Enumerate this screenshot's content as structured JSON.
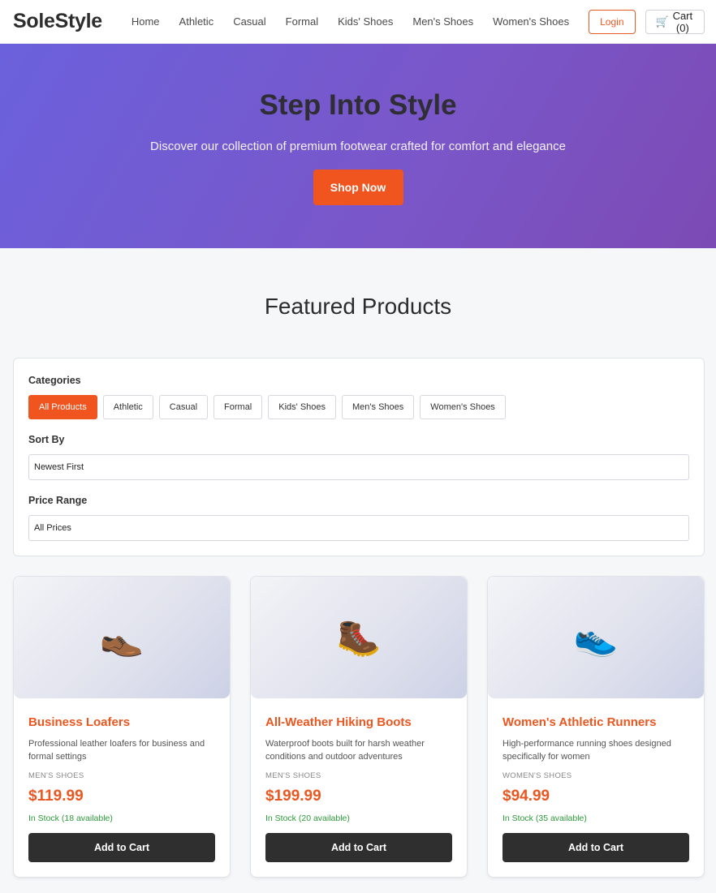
{
  "header": {
    "logo": "SoleStyle",
    "nav": [
      "Home",
      "Athletic",
      "Casual",
      "Formal",
      "Kids' Shoes",
      "Men's Shoes",
      "Women's Shoes"
    ],
    "login_label": "Login",
    "cart_label": "Cart (0)",
    "cart_icon": "🛒"
  },
  "hero": {
    "title": "Step Into Style",
    "subtitle": "Discover our collection of premium footwear crafted for comfort and elegance",
    "cta": "Shop Now"
  },
  "featured": {
    "title": "Featured Products"
  },
  "filters": {
    "categories_label": "Categories",
    "categories": [
      "All Products",
      "Athletic",
      "Casual",
      "Formal",
      "Kids' Shoes",
      "Men's Shoes",
      "Women's Shoes"
    ],
    "active_category": "All Products",
    "sort_label": "Sort By",
    "sort_value": "Newest First",
    "price_label": "Price Range",
    "price_value": "All Prices"
  },
  "products": [
    {
      "emoji": "👞",
      "title": "Business Loafers",
      "desc": "Professional leather loafers for business and formal settings",
      "category": "MEN'S SHOES",
      "price": "$119.99",
      "stock": "In Stock (18 available)",
      "button": "Add to Cart"
    },
    {
      "emoji": "🥾",
      "title": "All-Weather Hiking Boots",
      "desc": "Waterproof boots built for harsh weather conditions and outdoor adventures",
      "category": "MEN'S SHOES",
      "price": "$199.99",
      "stock": "In Stock (20 available)",
      "button": "Add to Cart"
    },
    {
      "emoji": "👟",
      "title": "Women's Athletic Runners",
      "desc": "High-performance running shoes designed specifically for women",
      "category": "WOMEN'S SHOES",
      "price": "$94.99",
      "stock": "In Stock (35 available)",
      "button": "Add to Cart"
    }
  ],
  "colors": {
    "accent": "#f0541f",
    "hero_start": "#6b61dc",
    "hero_end": "#7c4ab4",
    "stock_green": "#2e9a3a",
    "button_dark": "#2f2f2f"
  }
}
